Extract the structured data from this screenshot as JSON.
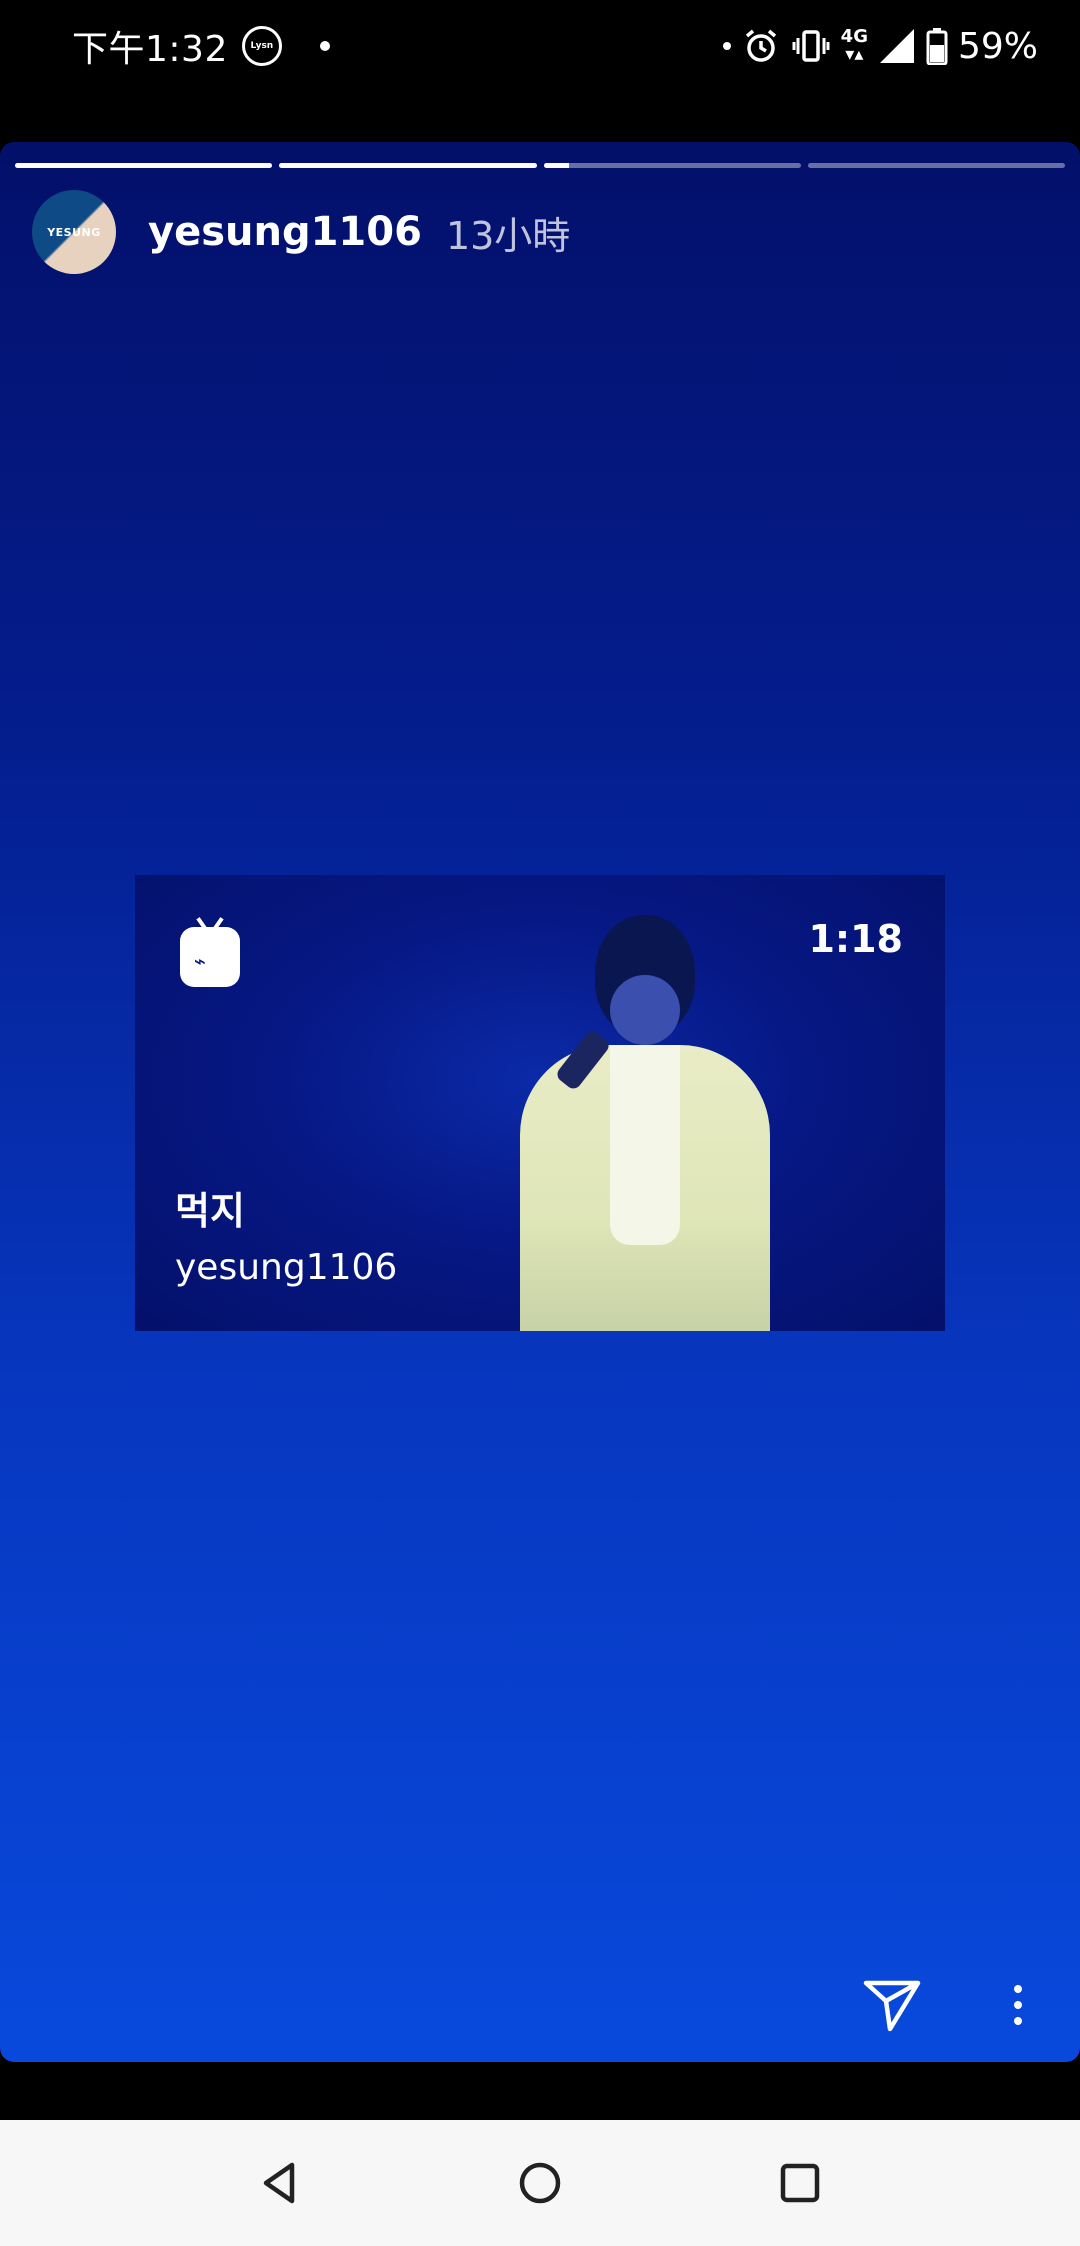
{
  "status_bar": {
    "time": "下午1:32",
    "app_icon_text": "Lysn",
    "network": "4G",
    "battery": "59%",
    "icons": [
      "lysn-icon",
      "alarm-icon",
      "vibrate-icon",
      "signal-icon",
      "battery-icon"
    ]
  },
  "story": {
    "progress": [
      1.0,
      1.0,
      0.1,
      0.0
    ],
    "avatar_text": "YESUNG",
    "username": "yesung1106",
    "timestamp": "13小時",
    "igtv": {
      "icon": "igtv-icon",
      "duration": "1:18",
      "title": "먹지",
      "username": "yesung1106"
    },
    "actions": {
      "share_icon": "send-icon",
      "more_icon": "more-vertical-icon"
    }
  },
  "nav_bar": {
    "icons": [
      "back-icon",
      "home-icon",
      "recents-icon"
    ]
  },
  "colors": {
    "story_top": "#03106a",
    "story_bottom": "#0849dc",
    "nav_bg": "#f7f7f7"
  }
}
